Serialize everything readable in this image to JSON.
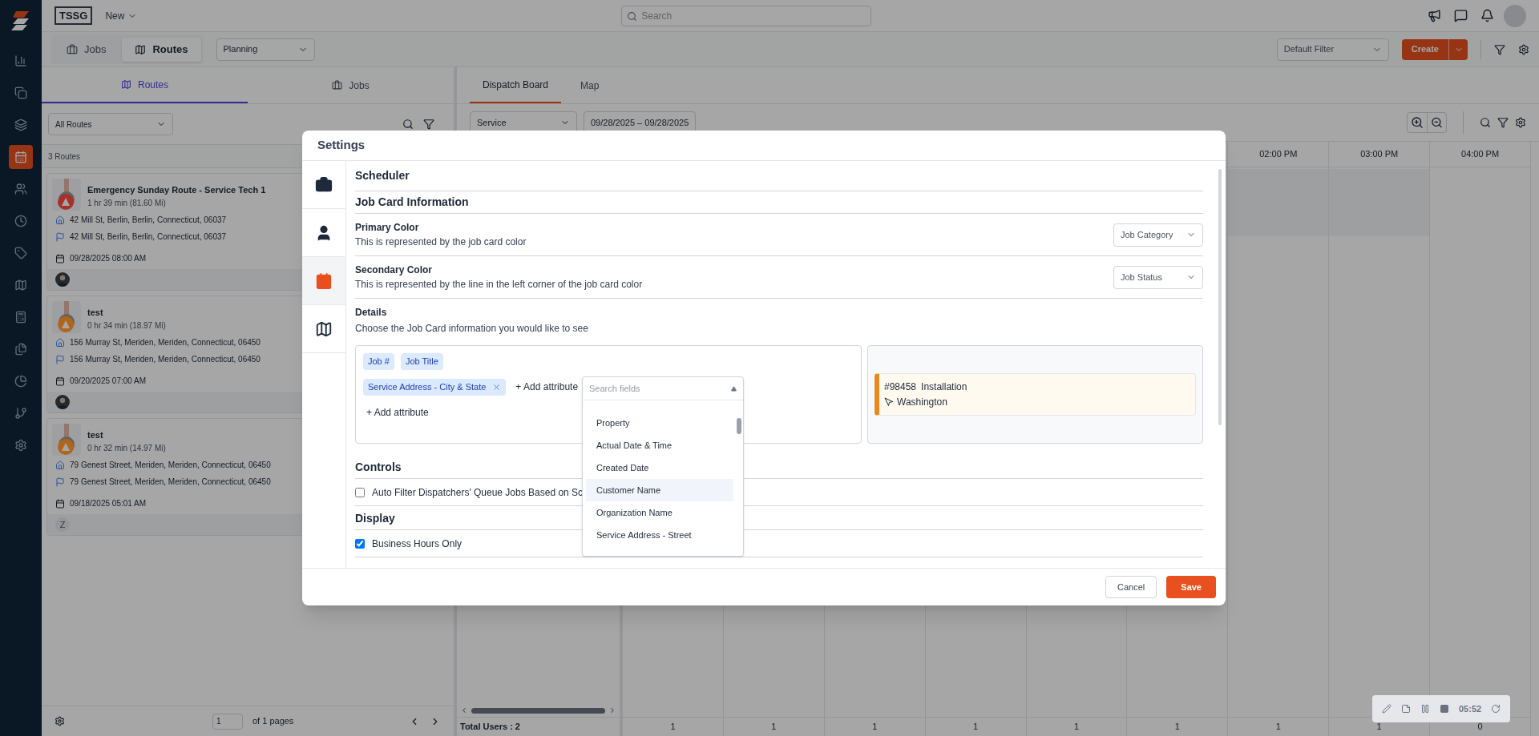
{
  "app": {
    "logo_text": "TSSG",
    "new_menu": "New",
    "search": {
      "placeholder": "Search"
    }
  },
  "nav_rail": [
    {
      "selected": false
    },
    {
      "selected": false
    },
    {
      "selected": false
    },
    {
      "selected": true
    },
    {
      "selected": false
    },
    {
      "selected": false
    },
    {
      "selected": false
    },
    {
      "selected": false
    },
    {
      "selected": false
    },
    {
      "selected": false
    },
    {
      "selected": false
    },
    {
      "selected": false
    },
    {
      "selected": false
    }
  ],
  "toolbar": {
    "view_tabs": [
      {
        "label": "Jobs",
        "selected": false
      },
      {
        "label": "Routes",
        "selected": true
      }
    ],
    "mode_select": "Planning",
    "filter_select": "Default Filter",
    "create_button": "Create"
  },
  "left_panel": {
    "tabs": [
      {
        "label": "Routes",
        "selected": true
      },
      {
        "label": "Jobs",
        "selected": false
      }
    ],
    "route_filter": "All Routes",
    "count": "3 Routes",
    "routes": [
      {
        "name": "Emergency Sunday Route - Service Tech 1",
        "duration": "1 hr 39 min (81.60 Mi)",
        "color": "#a8302a",
        "start": "42 Mill St, Berlin, Berlin, Connecticut, 06037",
        "end": "42 Mill St, Berlin, Berlin, Connecticut, 06037",
        "date": "09/28/2025 08:00 AM",
        "avatar": {
          "kind": "photo"
        }
      },
      {
        "name": "test",
        "duration": "0 hr 34 min (18.97 Mi)",
        "color": "#b0651c",
        "start": "156 Murray St, Meriden, Meriden, Connecticut, 06450",
        "end": "156 Murray St, Meriden, Meriden, Connecticut, 06450",
        "date": "09/20/2025 07:00 AM",
        "avatar": {
          "kind": "photo"
        }
      },
      {
        "name": "test",
        "duration": "0 hr 32 min (14.97 Mi)",
        "color": "#b0651c",
        "start": "79 Genest Street, Meriden, Meriden, Connecticut, 06450",
        "end": "79 Genest Street, Meriden, Meriden, Connecticut, 06450",
        "date": "09/18/2025 05:01 AM",
        "avatar": {
          "kind": "initial",
          "text": "Z"
        }
      }
    ],
    "pagination": {
      "page": "1",
      "of_pages": "of 1 pages"
    }
  },
  "board": {
    "tabs": [
      {
        "label": "Dispatch Board",
        "selected": true
      },
      {
        "label": "Map",
        "selected": false
      }
    ],
    "service_select": "Service",
    "date_range": "09/28/2025 – 09/28/2025",
    "hours": [
      "02:00 PM",
      "03:00 PM",
      "04:00 PM"
    ],
    "total_users": "Total Users : 2",
    "totals": [
      "1",
      "1",
      "1",
      "1",
      "1",
      "1",
      "1",
      "1",
      "0"
    ]
  },
  "recorder": {
    "time": "05:52"
  },
  "settings_dialog": {
    "title": "Settings",
    "nav": [
      {
        "selected": false
      },
      {
        "selected": false
      },
      {
        "selected": true
      },
      {
        "selected": false
      }
    ],
    "section_title": "Scheduler",
    "job_card_title": "Job Card Information",
    "color_rows": [
      {
        "label": "Primary Color",
        "description": "This is represented by the job card color",
        "value": "Job Category"
      },
      {
        "label": "Secondary Color",
        "description": "This is represented by the line in the left corner of the job card color",
        "value": "Job Status"
      }
    ],
    "details": {
      "label": "Details",
      "description": "Choose the Job Card information you would like to see",
      "attribute_rows": [
        {
          "chips": [
            {
              "label": "Job #",
              "removable": false
            },
            {
              "label": "Job Title",
              "removable": false
            }
          ]
        },
        {
          "chips": [
            {
              "label": "Service Address - City & State",
              "removable": true
            }
          ],
          "add_label": "+ Add attribute"
        },
        {
          "chips": [],
          "add_label": "+ Add attribute"
        }
      ]
    },
    "field_search": {
      "placeholder": "Search fields",
      "options": [
        {
          "label": "Property",
          "selected": false
        },
        {
          "label": "Actual Date & Time",
          "selected": false
        },
        {
          "label": "Created Date",
          "selected": false
        },
        {
          "label": "Customer Name",
          "selected": true
        },
        {
          "label": "Organization Name",
          "selected": false
        },
        {
          "label": "Service Address - Street",
          "selected": false
        }
      ]
    },
    "preview": {
      "job_number": "#98458",
      "job_title": "Installation",
      "location": "Washington"
    },
    "controls_title": "Controls",
    "controls": [
      {
        "label": "Auto Filter Dispatchers' Queue Jobs Based on Sc",
        "checked": false
      }
    ],
    "display_title": "Display",
    "display": [
      {
        "label": "Business Hours Only",
        "checked": true
      }
    ],
    "cancel_button": "Cancel",
    "save_button": "Save"
  }
}
